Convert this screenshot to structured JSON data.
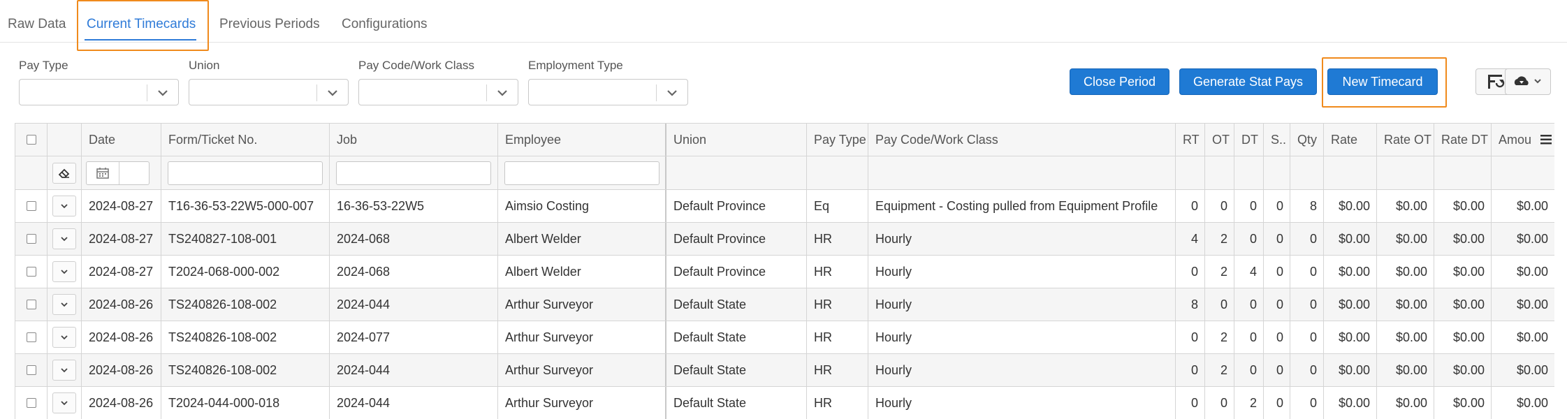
{
  "tabs": [
    {
      "label": "Raw Data",
      "active": false
    },
    {
      "label": "Current Timecards",
      "active": true
    },
    {
      "label": "Previous Periods",
      "active": false
    },
    {
      "label": "Configurations",
      "active": false
    }
  ],
  "filters": [
    {
      "label": "Pay Type",
      "value": ""
    },
    {
      "label": "Union",
      "value": ""
    },
    {
      "label": "Pay Code/Work Class",
      "value": ""
    },
    {
      "label": "Employment Type",
      "value": ""
    }
  ],
  "toolbar": {
    "close_period": "Close Period",
    "generate_stat_pays": "Generate Stat Pays",
    "new_timecard": "New Timecard",
    "column_chooser_icon": "column-settings-icon",
    "export_icon": "cloud-download-icon"
  },
  "colors": {
    "accent": "#1f7ad4",
    "tab_active": "#2f7bd8",
    "highlight": "#f08a1c"
  },
  "grid": {
    "columns": [
      "Date",
      "Form/Ticket No.",
      "Job",
      "Employee",
      "Union",
      "Pay Type",
      "Pay Code/Work Class",
      "RT",
      "OT",
      "DT",
      "S..",
      "Qty",
      "Rate",
      "Rate OT",
      "Rate DT",
      "Amou"
    ],
    "rows": [
      {
        "date": "2024-08-27",
        "ticket": "T16-36-53-22W5-000-007",
        "job": "16-36-53-22W5",
        "employee": "Aimsio Costing",
        "union": "Default Province",
        "pay_type": "Eq",
        "pay_code": "Equipment - Costing pulled from Equipment Profile",
        "rt": "0",
        "ot": "0",
        "dt": "0",
        "s": "0",
        "qty": "8",
        "rate": "$0.00",
        "rate_ot": "$0.00",
        "rate_dt": "$0.00",
        "amount": "$0.00"
      },
      {
        "date": "2024-08-27",
        "ticket": "TS240827-108-001",
        "job": "2024-068",
        "employee": "Albert Welder",
        "union": "Default Province",
        "pay_type": "HR",
        "pay_code": "Hourly",
        "rt": "4",
        "ot": "2",
        "dt": "0",
        "s": "0",
        "qty": "0",
        "rate": "$0.00",
        "rate_ot": "$0.00",
        "rate_dt": "$0.00",
        "amount": "$0.00"
      },
      {
        "date": "2024-08-27",
        "ticket": "T2024-068-000-002",
        "job": "2024-068",
        "employee": "Albert Welder",
        "union": "Default Province",
        "pay_type": "HR",
        "pay_code": "Hourly",
        "rt": "0",
        "ot": "2",
        "dt": "4",
        "s": "0",
        "qty": "0",
        "rate": "$0.00",
        "rate_ot": "$0.00",
        "rate_dt": "$0.00",
        "amount": "$0.00"
      },
      {
        "date": "2024-08-26",
        "ticket": "TS240826-108-002",
        "job": "2024-044",
        "employee": "Arthur Surveyor",
        "union": "Default State",
        "pay_type": "HR",
        "pay_code": "Hourly",
        "rt": "8",
        "ot": "0",
        "dt": "0",
        "s": "0",
        "qty": "0",
        "rate": "$0.00",
        "rate_ot": "$0.00",
        "rate_dt": "$0.00",
        "amount": "$0.00"
      },
      {
        "date": "2024-08-26",
        "ticket": "TS240826-108-002",
        "job": "2024-077",
        "employee": "Arthur Surveyor",
        "union": "Default State",
        "pay_type": "HR",
        "pay_code": "Hourly",
        "rt": "0",
        "ot": "2",
        "dt": "0",
        "s": "0",
        "qty": "0",
        "rate": "$0.00",
        "rate_ot": "$0.00",
        "rate_dt": "$0.00",
        "amount": "$0.00"
      },
      {
        "date": "2024-08-26",
        "ticket": "TS240826-108-002",
        "job": "2024-044",
        "employee": "Arthur Surveyor",
        "union": "Default State",
        "pay_type": "HR",
        "pay_code": "Hourly",
        "rt": "0",
        "ot": "2",
        "dt": "0",
        "s": "0",
        "qty": "0",
        "rate": "$0.00",
        "rate_ot": "$0.00",
        "rate_dt": "$0.00",
        "amount": "$0.00"
      },
      {
        "date": "2024-08-26",
        "ticket": "T2024-044-000-018",
        "job": "2024-044",
        "employee": "Arthur Surveyor",
        "union": "Default State",
        "pay_type": "HR",
        "pay_code": "Hourly",
        "rt": "0",
        "ot": "0",
        "dt": "2",
        "s": "0",
        "qty": "0",
        "rate": "$0.00",
        "rate_ot": "$0.00",
        "rate_dt": "$0.00",
        "amount": "$0.00"
      }
    ]
  }
}
